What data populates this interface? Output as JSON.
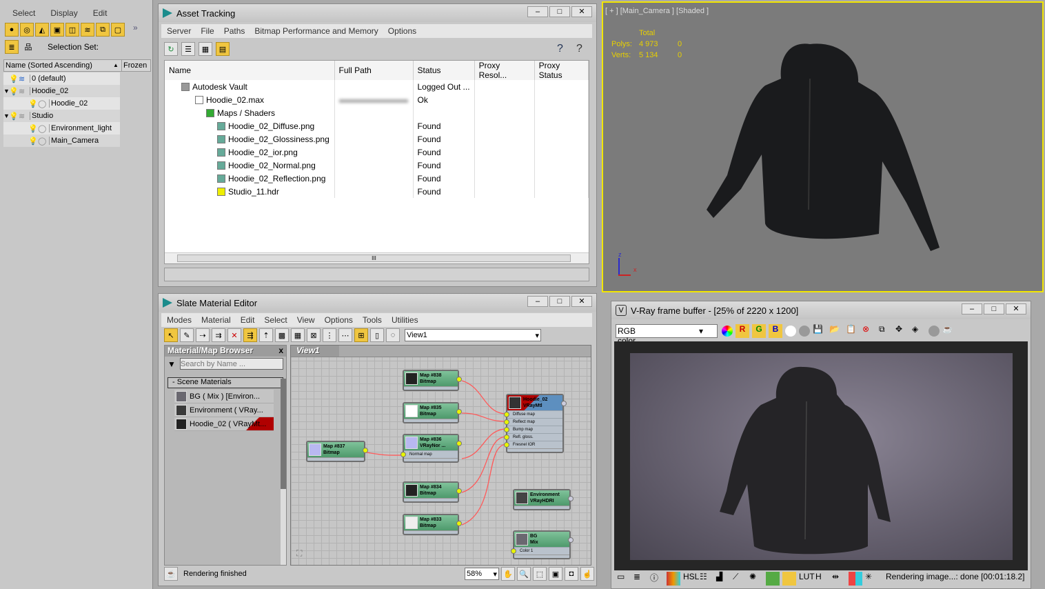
{
  "scene_explorer": {
    "menu": [
      "Select",
      "Display",
      "Edit"
    ],
    "selection_set_label": "Selection Set:",
    "columns": [
      "Name (Sorted Ascending)",
      "Frozen"
    ],
    "rows": [
      {
        "name": "0 (default)",
        "level": 0
      },
      {
        "name": "Hoodie_02",
        "level": 0
      },
      {
        "name": "Hoodie_02",
        "level": 1
      },
      {
        "name": "Studio",
        "level": 0
      },
      {
        "name": "Environment_light",
        "level": 1
      },
      {
        "name": "Main_Camera",
        "level": 1
      }
    ]
  },
  "asset_tracking": {
    "title": "Asset Tracking",
    "menu": [
      "Server",
      "File",
      "Paths",
      "Bitmap Performance and Memory",
      "Options"
    ],
    "columns": [
      "Name",
      "Full Path",
      "Status",
      "Proxy Resol...",
      "Proxy Status"
    ],
    "rows": [
      {
        "name": "Autodesk Vault",
        "status": "Logged Out ..."
      },
      {
        "name": "Hoodie_02.max",
        "status": "Ok"
      },
      {
        "name": "Maps / Shaders",
        "status": ""
      },
      {
        "name": "Hoodie_02_Diffuse.png",
        "status": "Found"
      },
      {
        "name": "Hoodie_02_Glossiness.png",
        "status": "Found"
      },
      {
        "name": "Hoodie_02_ior.png",
        "status": "Found"
      },
      {
        "name": "Hoodie_02_Normal.png",
        "status": "Found"
      },
      {
        "name": "Hoodie_02_Reflection.png",
        "status": "Found"
      },
      {
        "name": "Studio_11.hdr",
        "status": "Found"
      }
    ],
    "scroll_marker": "III"
  },
  "slate": {
    "title": "Slate Material Editor",
    "menu": [
      "Modes",
      "Material",
      "Edit",
      "Select",
      "View",
      "Options",
      "Tools",
      "Utilities"
    ],
    "view_select": "View1",
    "browser": {
      "title": "Material/Map Browser",
      "search_placeholder": "Search by Name ...",
      "group": "- Scene Materials",
      "items": [
        "BG  ( Mix )  [Environ...",
        "Environment  ( VRay...",
        "Hoodie_02  ( VRayMt..."
      ]
    },
    "view_tab": "View1",
    "nodes": {
      "m838": [
        "Map #838",
        "Bitmap"
      ],
      "m835": [
        "Map #835",
        "Bitmap"
      ],
      "m836": [
        "Map #836",
        "VRayNor ..."
      ],
      "m837": [
        "Map #837",
        "Bitmap"
      ],
      "m834": [
        "Map #834",
        "Bitmap"
      ],
      "m833": [
        "Map #833",
        "Bitmap"
      ],
      "hoodie": [
        "Hoodie_02",
        "VRayMtl"
      ],
      "env": [
        "Environment",
        "VRayHDRI"
      ],
      "bg": [
        "BG",
        "Mix"
      ]
    },
    "slots": {
      "normal": "Normal map",
      "diffuse": "Diffuse map",
      "reflect": "Reflect map",
      "bump": "Bump map",
      "gloss": "Refl. gloss.",
      "fresnel": "Fresnel IOR",
      "color1": "Color 1"
    },
    "status": "Rendering finished",
    "zoom": "58%"
  },
  "viewport": {
    "label": "[ + ] [Main_Camera ] [Shaded ]",
    "stats_header": "Total",
    "polys_label": "Polys:",
    "polys": "4 973",
    "polys_sel": "0",
    "verts_label": "Verts:",
    "verts": "5 134",
    "verts_sel": "0",
    "axis_z": "z",
    "axis_x": "x",
    "border_color": "#f2e600"
  },
  "vfb": {
    "title": "V-Ray frame buffer - [25% of 2220 x 1200]",
    "channel": "RGB color",
    "status": "Rendering image...: done [00:01:18.2]"
  }
}
